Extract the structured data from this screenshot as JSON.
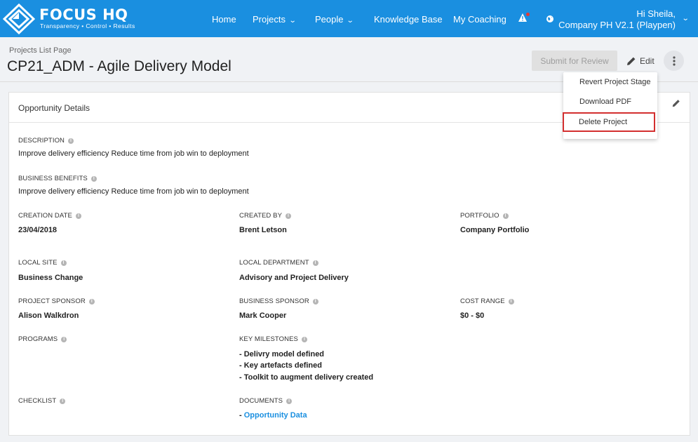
{
  "brand": {
    "title": "FOCUS HQ",
    "tagline": "Transparency • Control • Results"
  },
  "nav": {
    "home": "Home",
    "projects": "Projects",
    "people": "People",
    "knowledge_base": "Knowledge Base",
    "my_coaching": "My Coaching",
    "user_greeting": "Hi Sheila,",
    "user_company": "Company PH V2.1 (Playpen)"
  },
  "header": {
    "breadcrumb": "Projects List Page",
    "title": "CP21_ADM - Agile Delivery Model",
    "submit_label": "Submit for Review",
    "edit_label": "Edit"
  },
  "menu": {
    "items": [
      "Revert Project Stage",
      "Download PDF",
      "Delete Project"
    ]
  },
  "card": {
    "title": "Opportunity Details",
    "description_label": "DESCRIPTION",
    "description_value": "Improve delivery efficiency Reduce time from job win to deployment",
    "benefits_label": "BUSINESS BENEFITS",
    "benefits_value": "Improve delivery efficiency Reduce time from job win to deployment",
    "creation_date_label": "CREATION DATE",
    "creation_date_value": "23/04/2018",
    "created_by_label": "CREATED BY",
    "created_by_value": "Brent Letson",
    "portfolio_label": "PORTFOLIO",
    "portfolio_value": "Company Portfolio",
    "local_site_label": "LOCAL SITE",
    "local_site_value": "Business Change",
    "local_dept_label": "LOCAL DEPARTMENT",
    "local_dept_value": "Advisory and Project Delivery",
    "project_sponsor_label": "PROJECT SPONSOR",
    "project_sponsor_value": "Alison Walkdron",
    "business_sponsor_label": "BUSINESS SPONSOR",
    "business_sponsor_value": "Mark Cooper",
    "cost_range_label": "COST RANGE",
    "cost_range_value": "$0 - $0",
    "programs_label": "PROGRAMS",
    "milestones_label": "KEY MILESTONES",
    "milestones": [
      "- Delivry model defined",
      "- Key artefacts defined",
      "- Toolkit to augment delivery created"
    ],
    "checklist_label": "CHECKLIST",
    "documents_label": "DOCUMENTS",
    "document_prefix": "- ",
    "document_link": "Opportunity Data"
  },
  "colors": {
    "brand_blue": "#1a8fe0",
    "highlight_red": "#d32f2f",
    "alert_red": "#e53935"
  },
  "icons": [
    "focus-logo-icon",
    "chevron-down-icon",
    "alert-icon",
    "globe-icon",
    "pencil-icon",
    "more-vertical-icon",
    "info-icon"
  ]
}
